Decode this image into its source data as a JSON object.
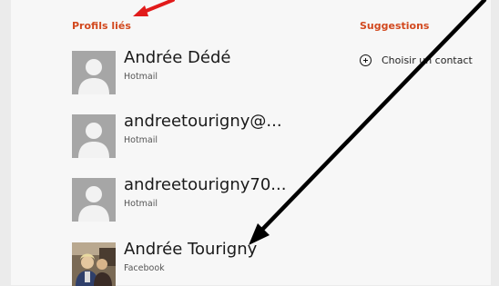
{
  "linked_profiles": {
    "title": "Profils liés",
    "items": [
      {
        "name": "Andrée Dédé",
        "source": "Hotmail",
        "avatar": "placeholder-person"
      },
      {
        "name": "andreetourigny@...",
        "source": "Hotmail",
        "avatar": "placeholder-person"
      },
      {
        "name": "andreetourigny70...",
        "source": "Hotmail",
        "avatar": "placeholder-person"
      },
      {
        "name": "Andrée Tourigny",
        "source": "Facebook",
        "avatar": "photo"
      }
    ]
  },
  "suggestions": {
    "title": "Suggestions",
    "action_label": "Choisir un contact",
    "action_icon": "plus-circle-icon"
  },
  "annotations": {
    "arrow_color": "#e11b1b",
    "pointer_color": "#000000"
  },
  "colors": {
    "accent": "#d2491f",
    "background": "#f7f7f7",
    "avatar_placeholder": "#a6a6a6"
  }
}
